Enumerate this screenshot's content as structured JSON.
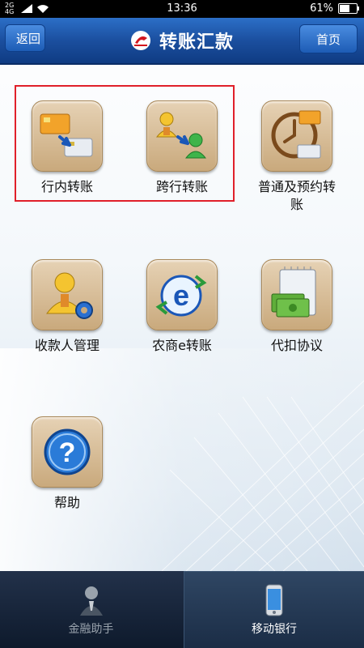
{
  "status_bar": {
    "network_top": "2G",
    "network_bottom": "4G",
    "time": "13:36",
    "battery": "61%",
    "battery_level": 0.61
  },
  "header": {
    "back_label": "返回",
    "title": "转账汇款",
    "home_label": "首页"
  },
  "menu": {
    "items": [
      {
        "label": "行内转账",
        "icon": "card-transfer-icon"
      },
      {
        "label": "跨行转账",
        "icon": "person-transfer-icon"
      },
      {
        "label": "普通及预约转账",
        "icon": "clock-card-icon"
      },
      {
        "label": "收款人管理",
        "icon": "payee-manage-icon"
      },
      {
        "label": "农商e转账",
        "icon": "e-transfer-icon"
      },
      {
        "label": "代扣协议",
        "icon": "money-notebook-icon"
      },
      {
        "label": "帮助",
        "icon": "question-icon"
      }
    ]
  },
  "bottom_nav": {
    "tabs": [
      {
        "label": "金融助手",
        "icon": "assistant-icon",
        "active": false
      },
      {
        "label": "移动银行",
        "icon": "mobile-phone-icon",
        "active": true
      }
    ]
  },
  "colors": {
    "header_blue": "#1b4f9f",
    "highlight_red": "#e0202a",
    "tile_tan": "#c9a97c"
  }
}
